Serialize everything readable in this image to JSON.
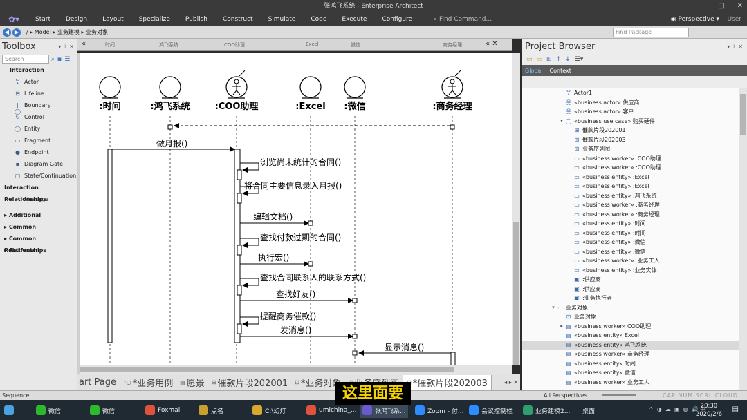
{
  "window": {
    "title": "张鸿飞系统 - Enterprise Architect",
    "menu": [
      "Start",
      "Design",
      "Layout",
      "Specialize",
      "Publish",
      "Construct",
      "Simulate",
      "Code",
      "Execute",
      "Configure"
    ],
    "find_command": "Find Command...",
    "perspective": "Perspective",
    "user": "User"
  },
  "addressbar": {
    "path": "/ ▸ Model ▸ 业务建模 ▸ 业务对象",
    "find_package_placeholder": "Find Package"
  },
  "toolbox": {
    "title": "Toolbox",
    "search_placeholder": "Search",
    "sections": [
      {
        "label": "Interaction",
        "items": [
          {
            "label": "Actor",
            "icon": "actor-icon"
          },
          {
            "label": "Lifeline",
            "icon": "lifeline-icon"
          },
          {
            "label": "Boundary",
            "icon": "boundary-icon"
          },
          {
            "label": "Control",
            "icon": "control-icon"
          },
          {
            "label": "Entity",
            "icon": "entity-icon"
          },
          {
            "label": "Fragment",
            "icon": "fragment-icon"
          },
          {
            "label": "Endpoint",
            "icon": "endpoint-icon"
          },
          {
            "label": "Diagram Gate",
            "icon": "diagram-gate-icon"
          },
          {
            "label": "State/Continuation",
            "icon": "state-icon"
          }
        ]
      },
      {
        "label": "Interaction Relationships",
        "items": [
          {
            "label": "Message",
            "icon": "message-icon"
          }
        ]
      }
    ],
    "collapsed_sections": [
      "Additional",
      "Common",
      "Common Relationships",
      "Artifacts"
    ]
  },
  "diagram_top_tabs": [
    "时间",
    "鸿飞系统",
    "COO助理",
    "Excel",
    "微信",
    "商务经理"
  ],
  "lifelines": [
    {
      "label": ":时间",
      "kind": "entity"
    },
    {
      "label": ":鸿飞系统",
      "kind": "entity"
    },
    {
      "label": ":COO助理",
      "kind": "worker"
    },
    {
      "label": ":Excel",
      "kind": "entity"
    },
    {
      "label": ":微信",
      "kind": "entity"
    },
    {
      "label": ":商务经理",
      "kind": "worker"
    }
  ],
  "messages": [
    {
      "label": "做月报()"
    },
    {
      "label": "浏览尚未统计的合同()"
    },
    {
      "label": "将合同主要信息录入月报()"
    },
    {
      "label": "编辑文档()"
    },
    {
      "label": "查找付款过期的合同()"
    },
    {
      "label": "执行宏()"
    },
    {
      "label": "查找合同联系人的联系方式()"
    },
    {
      "label": "查找好友()"
    },
    {
      "label": "提醒商务催款()"
    },
    {
      "label": "发消息()"
    },
    {
      "label": "显示消息()"
    }
  ],
  "bottom_tabs": [
    "art Page",
    "*业务用例",
    "愿景",
    "催款片段202001",
    "*业务对象",
    "业务序列图",
    "*催款片段202003"
  ],
  "project_browser": {
    "title": "Project Browser",
    "tabs": [
      "Global",
      "Context"
    ],
    "items": [
      {
        "label": "Actor1",
        "indent": 1,
        "icon": "actor-icon",
        "arrow": ""
      },
      {
        "label": "«business actor» 供应商",
        "indent": 1,
        "icon": "actor-icon",
        "arrow": ""
      },
      {
        "label": "«business actor» 客户",
        "indent": 1,
        "icon": "actor-icon",
        "arrow": ""
      },
      {
        "label": "«business use case» 购买硬件",
        "indent": 1,
        "icon": "use-case-icon",
        "arrow": "▾"
      },
      {
        "label": "催款片段202001",
        "indent": 2,
        "icon": "sequence-diagram-icon",
        "arrow": ""
      },
      {
        "label": "催款片段202003",
        "indent": 2,
        "icon": "sequence-diagram-icon",
        "arrow": ""
      },
      {
        "label": "业务序列图",
        "indent": 2,
        "icon": "sequence-diagram-icon",
        "arrow": ""
      },
      {
        "label": "«business worker» :COO助理",
        "indent": 2,
        "icon": "instance-icon",
        "arrow": ""
      },
      {
        "label": "«business worker» :COO助理",
        "indent": 2,
        "icon": "instance-icon",
        "arrow": ""
      },
      {
        "label": "«business entity» :Excel",
        "indent": 2,
        "icon": "instance-icon",
        "arrow": ""
      },
      {
        "label": "«business entity» :Excel",
        "indent": 2,
        "icon": "instance-icon",
        "arrow": ""
      },
      {
        "label": "«business entity» :鸿飞系统",
        "indent": 2,
        "icon": "instance-icon",
        "arrow": ""
      },
      {
        "label": "«business worker» :商务经理",
        "indent": 2,
        "icon": "instance-icon",
        "arrow": ""
      },
      {
        "label": "«business worker» :商务经理",
        "indent": 2,
        "icon": "instance-icon",
        "arrow": ""
      },
      {
        "label": "«business entity» :时间",
        "indent": 2,
        "icon": "instance-icon",
        "arrow": ""
      },
      {
        "label": "«business entity» :时间",
        "indent": 2,
        "icon": "instance-icon",
        "arrow": ""
      },
      {
        "label": "«business entity» :微信",
        "indent": 2,
        "icon": "instance-icon",
        "arrow": ""
      },
      {
        "label": "«business entity» :微信",
        "indent": 2,
        "icon": "instance-icon",
        "arrow": ""
      },
      {
        "label": "«business worker» :业务工人",
        "indent": 2,
        "icon": "instance-icon",
        "arrow": ""
      },
      {
        "label": "«business entity» :业务实体",
        "indent": 2,
        "icon": "instance-icon",
        "arrow": ""
      },
      {
        "label": ":供应商",
        "indent": 2,
        "icon": "actor-instance-icon",
        "arrow": ""
      },
      {
        "label": ":供应商",
        "indent": 2,
        "icon": "actor-instance-icon",
        "arrow": ""
      },
      {
        "label": ":业务执行者",
        "indent": 2,
        "icon": "actor-instance-icon",
        "arrow": ""
      },
      {
        "label": "业务对象",
        "indent": 0,
        "icon": "folder-icon",
        "arrow": "▾"
      },
      {
        "label": "业务对象",
        "indent": 1,
        "icon": "class-diagram-icon",
        "arrow": ""
      },
      {
        "label": "«business worker» COO助理",
        "indent": 1,
        "icon": "class-icon",
        "arrow": "▸"
      },
      {
        "label": "«business entity» Excel",
        "indent": 1,
        "icon": "class-icon",
        "arrow": ""
      },
      {
        "label": "«business entity» 鸿飞系统",
        "indent": 1,
        "icon": "class-icon",
        "arrow": "",
        "selected": true
      },
      {
        "label": "«business worker» 商务经理",
        "indent": 1,
        "icon": "class-icon",
        "arrow": ""
      },
      {
        "label": "«business entity» 时间",
        "indent": 1,
        "icon": "class-icon",
        "arrow": ""
      },
      {
        "label": "«business entity» 微信",
        "indent": 1,
        "icon": "class-icon",
        "arrow": ""
      },
      {
        "label": "«business worker» 业务工人",
        "indent": 1,
        "icon": "class-icon",
        "arrow": ""
      }
    ]
  },
  "statusbar": {
    "left": "Sequence",
    "perspective": "All Perspectives",
    "indicators": "CAP NUM SCRL CLOUD"
  },
  "taskbar": {
    "apps": [
      "微信",
      "微信",
      "Foxmail",
      "点名",
      "C:\\幻灯",
      "umlchina_...",
      "张鸿飞系...",
      "Zoom - 付...",
      "会议控制栏",
      "业务建模2..."
    ],
    "desktop": "桌面",
    "ime": "中",
    "time": "20:30",
    "date": "2020/2/6"
  },
  "subtitle": "这里面要",
  "colors": {
    "brand": "#a8a0ff",
    "accent": "#3b78c6",
    "subtitle_text": "#f5d400"
  }
}
